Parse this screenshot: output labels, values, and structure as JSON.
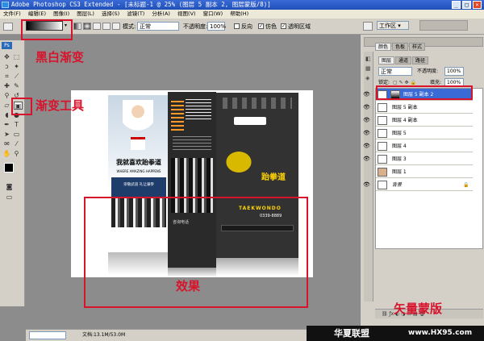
{
  "window": {
    "title": "Adobe Photoshop CS3 Extended - [未标题-1 @ 25% (图层 5 副本 2, 图层蒙版/8)]"
  },
  "menu": [
    "文件(F)",
    "编辑(E)",
    "图像(I)",
    "图层(L)",
    "选择(S)",
    "滤镜(T)",
    "分析(A)",
    "视图(V)",
    "窗口(W)",
    "帮助(H)"
  ],
  "options": {
    "mode_label": "模式:",
    "mode_value": "正常",
    "opacity_label": "不透明度:",
    "opacity_value": "100%",
    "reverse_label": "反向",
    "dither_label": "仿色",
    "transparency_label": "透明区域",
    "workspace_label": "工作区 ▾"
  },
  "annotations": {
    "gradient_bw": "黑白渐变",
    "gradient_tool": "渐变工具",
    "effect": "效果",
    "vector_mask": "矢量蒙版"
  },
  "canvas": {
    "left_slogan": "我就喜欢跆拳道",
    "left_sub": "WHERE AMAZING HAPPENS",
    "left_caption": "崇敬武道 礼让谦恭",
    "mid_phone_label": "咨询电话",
    "right_title": "跆拳道",
    "right_en": "TAEKWONDO",
    "right_phone": "0339-8889"
  },
  "status": {
    "doc": "文档:13.1M/53.0M"
  },
  "panels": {
    "top_tabs": [
      "颜色",
      "色板",
      "样式"
    ],
    "layer_tabs": [
      "图层",
      "通道",
      "路径"
    ],
    "blend_value": "正常",
    "opacity_label": "不透明度:",
    "opacity_value": "100%",
    "lock_label": "锁定:",
    "fill_label": "填充:",
    "fill_value": "100%",
    "layers": [
      {
        "name": "图层 5 副本 2"
      },
      {
        "name": "图层 5 副本"
      },
      {
        "name": "图层 4 副本"
      },
      {
        "name": "图层 5"
      },
      {
        "name": "图层 4"
      },
      {
        "name": "图层 3"
      },
      {
        "name": "图层 1"
      },
      {
        "name": "背景"
      }
    ]
  },
  "watermark": {
    "cn": "华夏联盟",
    "url": "www.HX95.com"
  }
}
